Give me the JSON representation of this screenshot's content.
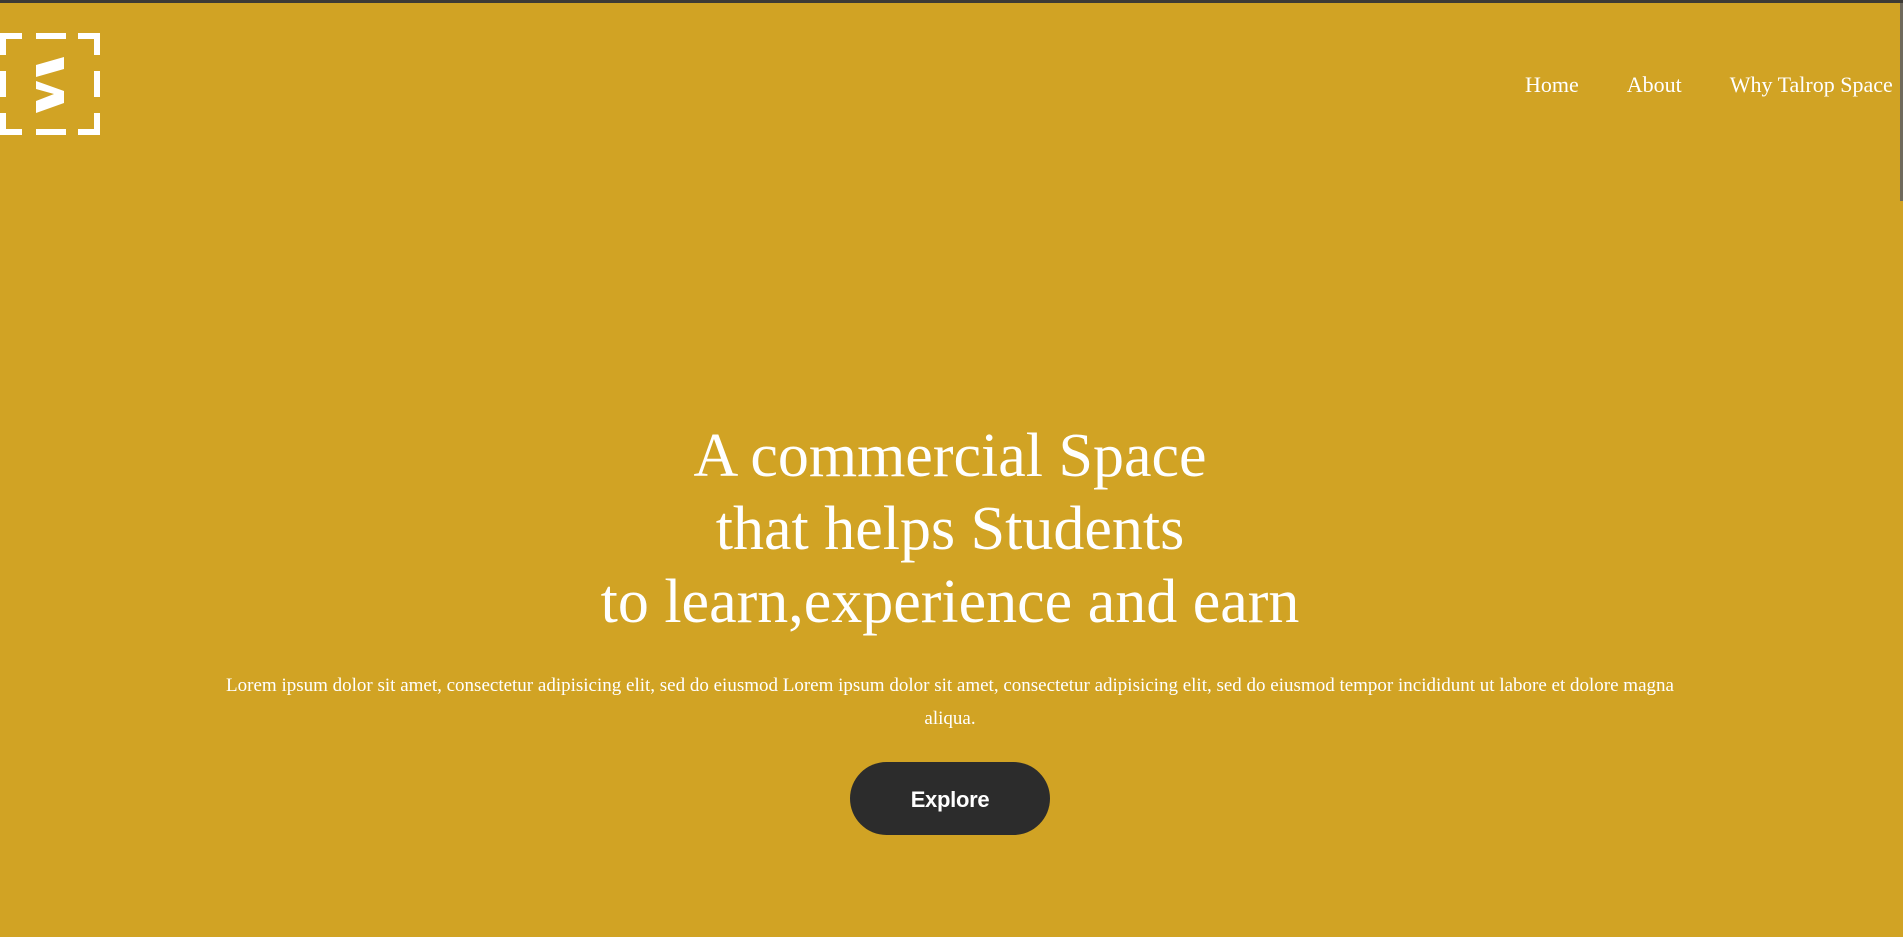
{
  "colors": {
    "background": "#d1a324",
    "text": "#ffffff",
    "button": "#2c2c2c",
    "topline": "#3d3b36"
  },
  "header": {
    "logo_icon": "talrop-space-logo-icon",
    "nav": [
      {
        "label": "Home"
      },
      {
        "label": "About"
      },
      {
        "label": "Why Talrop Space"
      }
    ]
  },
  "hero": {
    "title_lines": [
      "A commercial Space",
      "that helps Students",
      "to learn,experience and earn"
    ],
    "description": "Lorem ipsum dolor sit amet, consectetur adipisicing elit, sed do eiusmod Lorem ipsum dolor sit amet, consectetur adipisicing elit, sed do eiusmod tempor incididunt ut labore et dolore magna aliqua.",
    "cta_label": "Explore"
  }
}
